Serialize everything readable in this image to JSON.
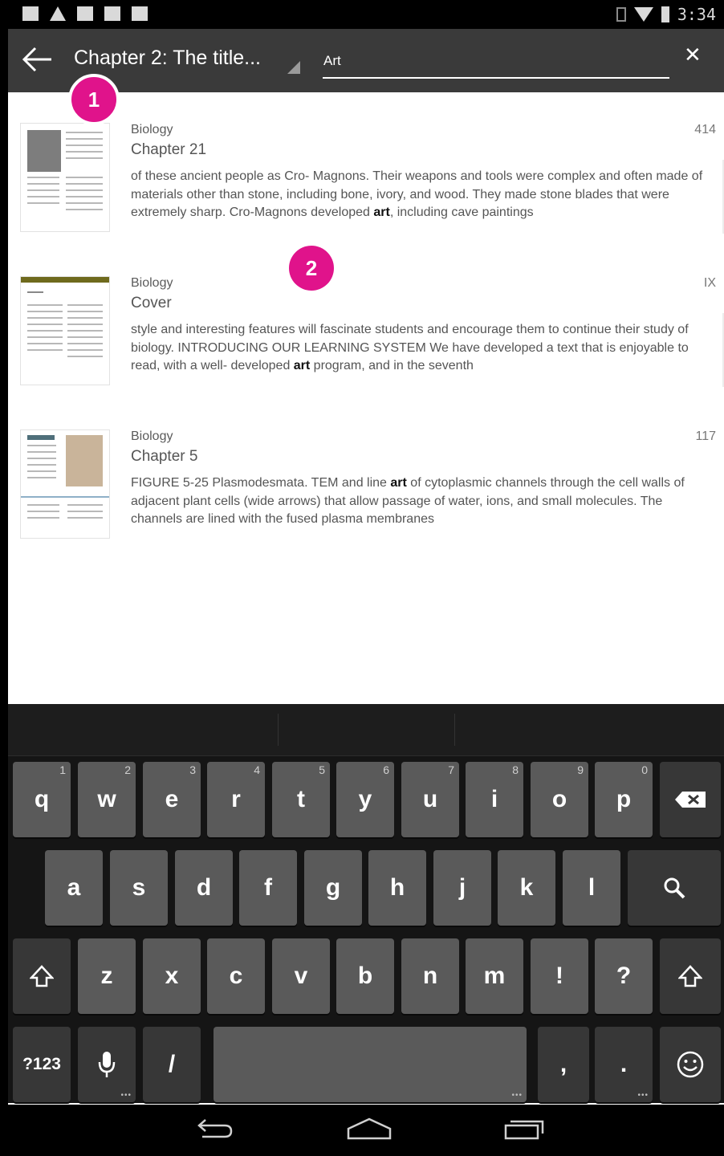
{
  "status_bar": {
    "time": "3:34",
    "left_icons": [
      "screenshot-icon",
      "warning-icon",
      "download-icon",
      "bag-icon",
      "bag-icon"
    ],
    "right_icons": [
      "vibrate-icon",
      "wifi-icon",
      "battery-icon"
    ]
  },
  "header": {
    "back_icon": "arrow-left-icon",
    "chapter_title": "Chapter 2: The title...",
    "search_value": "Art",
    "close_icon": "close-icon"
  },
  "badges": [
    "1",
    "2"
  ],
  "results": [
    {
      "book": "Biology",
      "chapter": "Chapter 21",
      "page": "414",
      "snippet_before": "of these ancient people as Cro- Magnons. Their weapons and tools were complex and often made of materials other than stone, including bone, ivory, and wood. They made stone blades that were extremely sharp. Cro-Magnons developed ",
      "snippet_match": "art",
      "snippet_after": ", including cave paintings"
    },
    {
      "book": "Biology",
      "chapter": "Cover",
      "page": "IX",
      "snippet_before": "style and interesting features will fascinate students and encourage them to continue their study of biology. INTRODUCING OUR LEARNING SYSTEM We have developed a text that is enjoyable to read, with a well- developed ",
      "snippet_match": "art",
      "snippet_after": " program, and in the seventh"
    },
    {
      "book": "Biology",
      "chapter": "Chapter 5",
      "page": "117",
      "snippet_before": "FIGURE 5-25 Plasmodesmata. TEM and line ",
      "snippet_match": "art",
      "snippet_after": " of cytoplasmic channels through the cell walls of adjacent plant cells (wide arrows) that allow passage of water, ions, and small molecules. The channels are lined with the fused plasma membranes"
    }
  ],
  "keyboard": {
    "row1": [
      {
        "label": "q",
        "hint": "1"
      },
      {
        "label": "w",
        "hint": "2"
      },
      {
        "label": "e",
        "hint": "3"
      },
      {
        "label": "r",
        "hint": "4"
      },
      {
        "label": "t",
        "hint": "5"
      },
      {
        "label": "y",
        "hint": "6"
      },
      {
        "label": "u",
        "hint": "7"
      },
      {
        "label": "i",
        "hint": "8"
      },
      {
        "label": "o",
        "hint": "9"
      },
      {
        "label": "p",
        "hint": "0"
      }
    ],
    "row2": [
      "a",
      "s",
      "d",
      "f",
      "g",
      "h",
      "j",
      "k",
      "l"
    ],
    "row3": [
      "z",
      "x",
      "c",
      "v",
      "b",
      "n",
      "m",
      "!",
      "?"
    ],
    "symbols_label": "?123",
    "slash_label": "/",
    "comma_label": ",",
    "period_label": ".",
    "backspace_icon": "backspace-icon",
    "search_icon": "search-icon",
    "shift_icon": "shift-icon",
    "mic_icon": "microphone-icon",
    "emoji_icon": "emoji-icon"
  },
  "nav_bar": {
    "icons": [
      "back-nav-icon",
      "home-icon",
      "recents-icon"
    ]
  },
  "colors": {
    "header_bg": "#3a3a3a",
    "badge": "#e0138b",
    "key": "#5a5a5a",
    "key_dark": "#373737",
    "keyboard_bg": "#151515"
  }
}
